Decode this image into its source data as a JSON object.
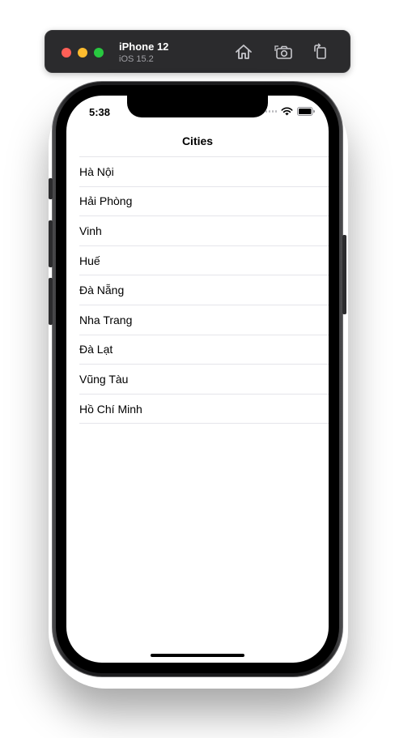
{
  "simulator": {
    "device_name": "iPhone 12",
    "os_version": "iOS 15.2",
    "buttons": [
      {
        "name": "home-button",
        "icon": "home-icon"
      },
      {
        "name": "screenshot-button",
        "icon": "camera-icon"
      },
      {
        "name": "rotate-button",
        "icon": "rotate-icon"
      }
    ]
  },
  "status_bar": {
    "time": "5:38",
    "icons": [
      "signal-icon",
      "wifi-icon",
      "battery-icon"
    ]
  },
  "nav": {
    "title": "Cities"
  },
  "cities": [
    "Hà Nội",
    "Hải Phòng",
    "Vinh",
    "Huế",
    "Đà Nẵng",
    "Nha Trang",
    "Đà Lạt",
    "Vũng Tàu",
    "Hồ Chí Minh"
  ],
  "colors": {
    "toolbar_bg": "#2b2b2d",
    "traffic_red": "#ff5f57",
    "traffic_yellow": "#febc2e",
    "traffic_green": "#28c840",
    "separator": "#e5e5ea"
  }
}
